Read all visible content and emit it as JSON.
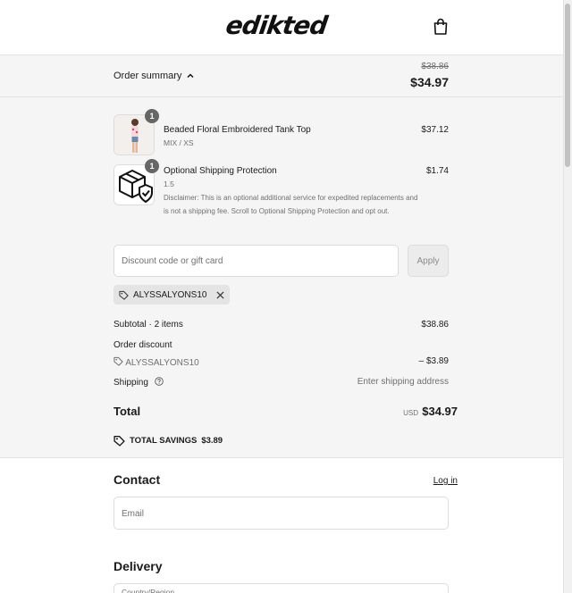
{
  "header": {
    "logo_text": "edikted"
  },
  "summary_bar": {
    "toggle_label": "Order summary",
    "original_total": "$38.86",
    "total": "$34.97"
  },
  "items": [
    {
      "name": "Beaded Floral Embroidered Tank Top",
      "variant": "MIX / XS",
      "price": "$37.12",
      "quantity": "1",
      "thumbnail": "tank-top-photo"
    },
    {
      "name": "Optional Shipping Protection",
      "variant": "1.5",
      "price": "$1.74",
      "quantity": "1",
      "thumbnail": "shipping-protection-icon",
      "disclaimer": "Disclaimer: This is an optional additional service for expedited replacements and is not a shipping fee. Scroll to Optional Shipping Protection and opt out."
    }
  ],
  "discount": {
    "placeholder": "Discount code or gift card",
    "apply_label": "Apply",
    "applied_code": "ALYSSALYONS10"
  },
  "totals": {
    "subtotal_label": "Subtotal · 2 items",
    "subtotal_value": "$38.86",
    "order_discount_label": "Order discount",
    "discount_code": "ALYSSALYONS10",
    "discount_value": "– $3.89",
    "shipping_label": "Shipping",
    "shipping_value": "Enter shipping address",
    "total_label": "Total",
    "currency": "USD",
    "total_value": "$34.97",
    "savings_label": "TOTAL SAVINGS",
    "savings_value": "$3.89"
  },
  "contact": {
    "title": "Contact",
    "login_label": "Log in",
    "email_placeholder": "Email"
  },
  "delivery": {
    "title": "Delivery",
    "country_placeholder": "Country/Region"
  },
  "colors": {
    "panel_bg": "#f5f5f5",
    "border": "#dcdcdc",
    "text": "#1a1a1a",
    "muted": "#707070",
    "badge": "#666666"
  }
}
